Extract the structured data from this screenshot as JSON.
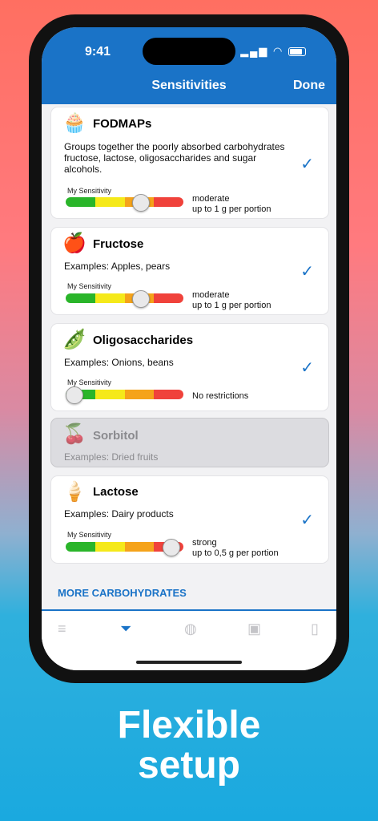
{
  "status_bar": {
    "time": "9:41",
    "signal": "▂▄▆",
    "wifi": "◠"
  },
  "nav": {
    "title": "Sensitivities",
    "done_label": "Done"
  },
  "scale_colors": [
    "#2ab52a",
    "#f5e91a",
    "#f5a31a",
    "#f0423b"
  ],
  "cards": [
    {
      "icon": "🧁",
      "title": "FODMAPs",
      "description": "Groups together the poorly absorbed carbohydrates fructose, lactose, oligosaccharides and sugar alcohols.",
      "sensitivity_label": "My Sensitivity",
      "level_line1": "moderate",
      "level_line2": "up to 1 g per portion",
      "level_fraction": 0.65,
      "checked": "✓"
    },
    {
      "icon": "🍎",
      "title": "Fructose",
      "description": "Examples: Apples, pears",
      "sensitivity_label": "My Sensitivity",
      "level_line1": "moderate",
      "level_line2": "up to 1 g per portion",
      "level_fraction": 0.65,
      "checked": "✓"
    },
    {
      "icon": "🫛",
      "title": "Oligosaccharides",
      "description": "Examples: Onions, beans",
      "sensitivity_label": "My Sensitivity",
      "level_line1": "No restrictions",
      "level_line2": "",
      "level_fraction": 0.0,
      "checked": "✓"
    },
    {
      "icon": "🍒",
      "title": "Sorbitol",
      "description": "Examples: Dried fruits",
      "disabled": true
    },
    {
      "icon": "🍦",
      "title": "Lactose",
      "description": "Examples: Dairy products",
      "sensitivity_label": "My Sensitivity",
      "level_line1": "strong",
      "level_line2": "up to 0,5 g per portion",
      "level_fraction": 0.95,
      "checked": "✓"
    }
  ],
  "section": {
    "more_carbohydrates": "MORE CARBOHYDRATES"
  },
  "tabbar": [
    {
      "icon": "list-icon",
      "glyph": "≡"
    },
    {
      "icon": "funnel-icon",
      "glyph": "⏷",
      "active": true
    },
    {
      "icon": "pig-icon",
      "glyph": "◍"
    },
    {
      "icon": "sodium-icon",
      "glyph": "▣"
    },
    {
      "icon": "ruler-icon",
      "glyph": "▯"
    }
  ],
  "tagline": {
    "line1": "Flexible",
    "line2": "setup"
  }
}
